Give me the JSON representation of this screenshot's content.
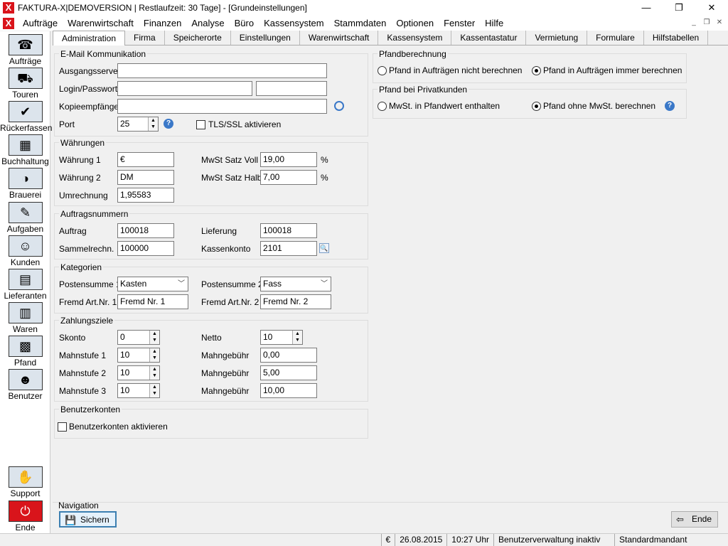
{
  "window": {
    "title": "FAKTURA-X|DEMOVERSION | Restlaufzeit: 30 Tage] - [Grundeinstellungen]",
    "app_icon": "X"
  },
  "menu": [
    "Aufträge",
    "Warenwirtschaft",
    "Finanzen",
    "Analyse",
    "Büro",
    "Kassensystem",
    "Stammdaten",
    "Optionen",
    "Fenster",
    "Hilfe"
  ],
  "sidebar": [
    {
      "label": "Aufträge",
      "icon": "headset-agent-icon"
    },
    {
      "label": "Touren",
      "icon": "truck-icon"
    },
    {
      "label": "Rückerfassen",
      "icon": "delivery-truck-icon"
    },
    {
      "label": "Buchhaltung",
      "icon": "calculator-icon"
    },
    {
      "label": "Brauerei",
      "icon": "brewery-icon"
    },
    {
      "label": "Aufgaben",
      "icon": "tasks-icon"
    },
    {
      "label": "Kunden",
      "icon": "customers-icon"
    },
    {
      "label": "Lieferanten",
      "icon": "suppliers-icon"
    },
    {
      "label": "Waren",
      "icon": "goods-icon"
    },
    {
      "label": "Pfand",
      "icon": "deposit-crate-icon"
    },
    {
      "label": "Benutzer",
      "icon": "user-icon"
    }
  ],
  "sidebar_bottom": [
    {
      "label": "Support",
      "icon": "handshake-icon"
    },
    {
      "label": "Ende",
      "icon": "power-icon"
    }
  ],
  "tabs": [
    "Administration",
    "Firma",
    "Speicherorte",
    "Einstellungen",
    "Warenwirtschaft",
    "Kassensystem",
    "Kassentastatur",
    "Vermietung",
    "Formulare",
    "Hilfstabellen"
  ],
  "email": {
    "title": "E-Mail Kommunikation",
    "server_label": "Ausgangsserver",
    "server": "",
    "login_label": "Login/Passwort",
    "login": "",
    "password": "",
    "copy_label": "Kopieempfänger",
    "copy": "",
    "port_label": "Port",
    "port": "25",
    "tls_label": "TLS/SSL aktivieren"
  },
  "waehrungen": {
    "title": "Währungen",
    "w1_label": "Währung 1",
    "w1": "€",
    "w2_label": "Währung 2",
    "w2": "DM",
    "umr_label": "Umrechnung",
    "umr": "1,95583",
    "mwst_voll_label": "MwSt Satz Voll",
    "mwst_voll": "19,00",
    "mwst_halb_label": "MwSt Satz Halb",
    "mwst_halb": "7,00",
    "pct": "%"
  },
  "auftragsnummern": {
    "title": "Auftragsnummern",
    "auftrag_label": "Auftrag",
    "auftrag": "100018",
    "sammel_label": "Sammelrechn.",
    "sammel": "100000",
    "lieferung_label": "Lieferung",
    "lieferung": "100018",
    "kasse_label": "Kassenkonto",
    "kasse": "2101"
  },
  "kategorien": {
    "title": "Kategorien",
    "ps1_label": "Postensumme 1",
    "ps1": "Kasten",
    "ps2_label": "Postensumme 2",
    "ps2": "Fass",
    "fa1_label": "Fremd Art.Nr. 1",
    "fa1": "Fremd Nr. 1",
    "fa2_label": "Fremd Art.Nr. 2",
    "fa2": "Fremd Nr. 2"
  },
  "zahlungsziele": {
    "title": "Zahlungsziele",
    "skonto_label": "Skonto",
    "skonto": "0",
    "netto_label": "Netto",
    "netto": "10",
    "m1_label": "Mahnstufe 1",
    "m1": "10",
    "m2_label": "Mahnstufe 2",
    "m2": "10",
    "m3_label": "Mahnstufe 3",
    "m3": "10",
    "g_label": "Mahngebühr",
    "g1": "0,00",
    "g2": "5,00",
    "g3": "10,00"
  },
  "benutzerkonten": {
    "title": "Benutzerkonten",
    "chk_label": "Benutzerkonten aktivieren"
  },
  "pfand": {
    "title": "Pfandberechnung",
    "opt1": "Pfand in Aufträgen nicht berechnen",
    "opt2": "Pfand in Aufträgen immer berechnen"
  },
  "privat": {
    "title": "Pfand bei Privatkunden",
    "opt1": "MwSt. in Pfandwert enthalten",
    "opt2": "Pfand ohne MwSt. berechnen"
  },
  "navigation": {
    "title": "Navigation",
    "save": "Sichern",
    "end": "Ende"
  },
  "status": {
    "currency": "€",
    "date": "26.08.2015",
    "time": "10:27 Uhr",
    "user": "Benutzerverwaltung inaktiv",
    "client": "Standardmandant"
  }
}
